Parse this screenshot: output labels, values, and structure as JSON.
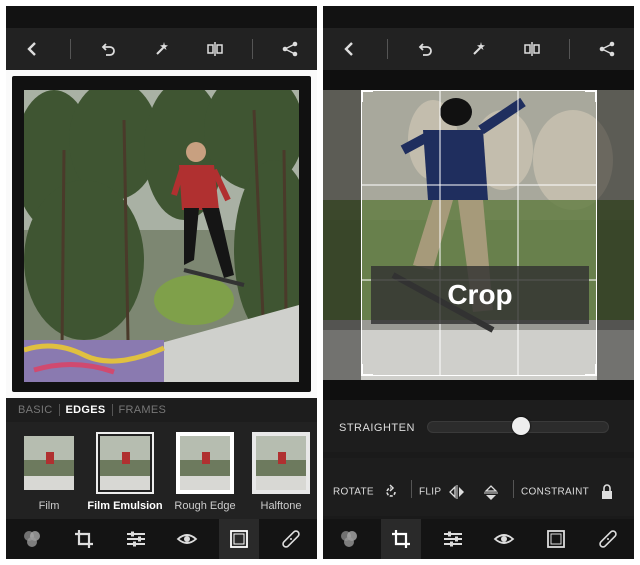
{
  "left": {
    "tabs": [
      {
        "label": "BASIC",
        "active": false
      },
      {
        "label": "EDGES",
        "active": true
      },
      {
        "label": "FRAMES",
        "active": false
      }
    ],
    "thumbnails": [
      {
        "label": "Film",
        "selected": false
      },
      {
        "label": "Film Emulsion",
        "selected": true
      },
      {
        "label": "Rough Edge",
        "selected": false
      },
      {
        "label": "Halftone",
        "selected": false
      }
    ],
    "active_bottom_tool": "frame-icon"
  },
  "right": {
    "crop_label": "Crop",
    "straighten_label": "STRAIGHTEN",
    "straighten_value": 0.5,
    "controls": {
      "rotate_label": "ROTATE",
      "flip_label": "FLIP",
      "constraint_label": "CONSTRAINT"
    },
    "active_bottom_tool": "crop-icon"
  },
  "toolbar_icons": [
    "back-icon",
    "undo-icon",
    "auto-fix-wand-icon",
    "compare-icon",
    "share-icon"
  ],
  "bottom_icons": [
    "color-filters-icon",
    "crop-icon",
    "adjustments-sliders-icon",
    "red-eye-icon",
    "frame-icon",
    "bandage-heal-icon"
  ],
  "colors": {
    "panel_bg": "#1a1a1a",
    "toolbar_bg": "#222222",
    "active_text": "#ffffff",
    "inactive_text": "#777777"
  }
}
